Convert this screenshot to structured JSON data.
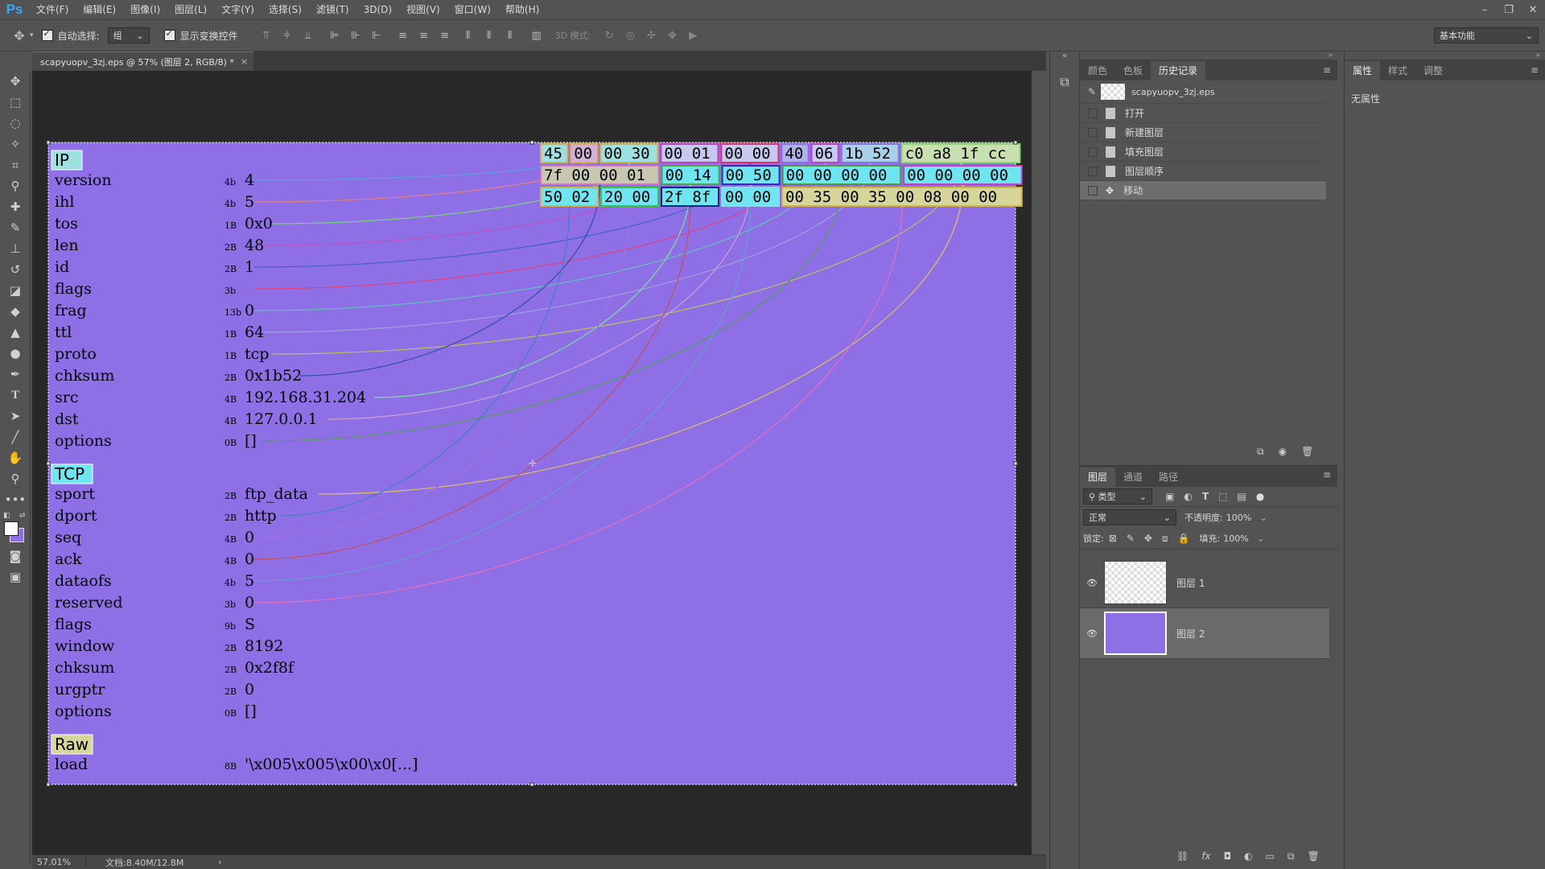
{
  "app": {
    "logo": "Ps",
    "window_controls": [
      "–",
      "❐",
      "✕"
    ]
  },
  "menu": [
    "文件(F)",
    "编辑(E)",
    "图像(I)",
    "图层(L)",
    "文字(Y)",
    "选择(S)",
    "滤镜(T)",
    "3D(D)",
    "视图(V)",
    "窗口(W)",
    "帮助(H)"
  ],
  "options": {
    "auto_select_label": "自动选择:",
    "auto_select_value": "组",
    "show_transform_label": "显示变换控件",
    "mode_3d_label": "3D 模式:",
    "workspace": "基本功能"
  },
  "document": {
    "tab_title": "scapyuopv_3zj.eps @ 57% (图层 2, RGB/8) *",
    "tab_close": "×",
    "zoom": "57.01%",
    "doc_info": "文档:8.40M/12.8M",
    "status_arrow": "›"
  },
  "canvas": {
    "bg_color": "#8e6fe6",
    "sections": [
      {
        "title": "IP",
        "title_bg": "#9ce0e0",
        "fields": [
          {
            "name": "version",
            "size": "4b",
            "value": "4"
          },
          {
            "name": "ihl",
            "size": "4b",
            "value": "5"
          },
          {
            "name": "tos",
            "size": "1B",
            "value": "0x0"
          },
          {
            "name": "len",
            "size": "2B",
            "value": "48"
          },
          {
            "name": "id",
            "size": "2B",
            "value": "1"
          },
          {
            "name": "flags",
            "size": "3b",
            "value": ""
          },
          {
            "name": "frag",
            "size": "13b",
            "value": "0"
          },
          {
            "name": "ttl",
            "size": "1B",
            "value": "64"
          },
          {
            "name": "proto",
            "size": "1B",
            "value": "tcp"
          },
          {
            "name": "chksum",
            "size": "2B",
            "value": "0x1b52"
          },
          {
            "name": "src",
            "size": "4B",
            "value": "192.168.31.204"
          },
          {
            "name": "dst",
            "size": "4B",
            "value": "127.0.0.1"
          },
          {
            "name": "options",
            "size": "0B",
            "value": "[]"
          }
        ]
      },
      {
        "title": "TCP",
        "title_bg": "#6ee6f2",
        "fields": [
          {
            "name": "sport",
            "size": "2B",
            "value": "ftp_data"
          },
          {
            "name": "dport",
            "size": "2B",
            "value": "http"
          },
          {
            "name": "seq",
            "size": "4B",
            "value": "0"
          },
          {
            "name": "ack",
            "size": "4B",
            "value": "0"
          },
          {
            "name": "dataofs",
            "size": "4b",
            "value": "5"
          },
          {
            "name": "reserved",
            "size": "3b",
            "value": "0"
          },
          {
            "name": "flags",
            "size": "9b",
            "value": "S"
          },
          {
            "name": "window",
            "size": "2B",
            "value": "8192"
          },
          {
            "name": "chksum",
            "size": "2B",
            "value": "0x2f8f"
          },
          {
            "name": "urgptr",
            "size": "2B",
            "value": "0"
          },
          {
            "name": "options",
            "size": "0B",
            "value": "[]"
          }
        ]
      },
      {
        "title": "Raw",
        "title_bg": "#d6d69a",
        "fields": [
          {
            "name": "load",
            "size": "8B",
            "value": "'\\x005\\x005\\x00\\x0[...]"
          }
        ]
      }
    ],
    "hex_rows": [
      [
        {
          "text": "45",
          "bg": "#9ce0e0",
          "border": "#d8b04a"
        },
        {
          "text": "00",
          "bg": "#d2b0d8",
          "border": "#d8b04a"
        },
        {
          "text": "00 30",
          "bg": "#9ce0e0",
          "border": "#d8b04a"
        },
        {
          "text": "00 01",
          "bg": "#c6c8ee",
          "border": "#c040c0"
        },
        {
          "text": "00 00",
          "bg": "#c6c8ee",
          "border": "#e03070"
        },
        {
          "text": "40",
          "bg": "#b0b0e8",
          "border": "#8e6fe6"
        },
        {
          "text": "06",
          "bg": "#c6c8ee",
          "border": "#c040c0"
        },
        {
          "text": "1b 52",
          "bg": "#a8d0e8",
          "border": "#8e6fe6"
        },
        {
          "text": "c0 a8 1f cc",
          "bg": "#c8e0b0",
          "border": "#8ad87a"
        }
      ],
      [
        {
          "text": "7f 00 00 01",
          "bg": "#c8c8b0",
          "border": "#d07ab0"
        },
        {
          "text": "00 14",
          "bg": "#6ee6f2",
          "border": "#40b040"
        },
        {
          "text": "00 50",
          "bg": "#6ee6f2",
          "border": "#3030c0"
        },
        {
          "text": "00 00 00 00",
          "bg": "#6ee6f2",
          "border": "#40a040"
        },
        {
          "text": "00 00 00 00",
          "bg": "#6ee6f2",
          "border": "#c040c0"
        }
      ],
      [
        {
          "text": "50 02",
          "bg": "#6ee6f2",
          "border": "#d8b04a"
        },
        {
          "text": "20 00",
          "bg": "#6ee6f2",
          "border": "#40c040"
        },
        {
          "text": "2f 8f",
          "bg": "#6ee6f2",
          "border": "#202080"
        },
        {
          "text": "00 00",
          "bg": "#6ee6f2",
          "border": "#a0d0f0"
        },
        {
          "text": "00 35 00 35 00 08 00 00",
          "bg": "#d6d69a",
          "border": "#d8b04a"
        }
      ]
    ]
  },
  "history_panel": {
    "tabs": [
      "颜色",
      "色板",
      "历史记录"
    ],
    "active_tab": 2,
    "snapshot": "scapyuopv_3zj.eps",
    "items": [
      "打开",
      "新建图层",
      "填充图层",
      "图层顺序",
      "移动"
    ],
    "selected_item": 4
  },
  "properties_panel": {
    "tabs": [
      "属性",
      "样式",
      "调整"
    ],
    "active_tab": 0,
    "content": "无属性"
  },
  "layers_panel": {
    "tabs": [
      "图层",
      "通道",
      "路径"
    ],
    "active_tab": 0,
    "filter_label": "类型",
    "blend_mode": "正常",
    "opacity_label": "不透明度:",
    "opacity": "100%",
    "lock_label": "锁定:",
    "fill_label": "填充:",
    "fill": "100%",
    "layers": [
      {
        "name": "图层 1",
        "thumb": "checker",
        "selected": false
      },
      {
        "name": "图层 2",
        "thumb": "#8e6fe6",
        "selected": true
      }
    ],
    "footer_icons": [
      "link-icon",
      "fx-icon",
      "mask-icon",
      "adjust-icon",
      "folder-icon",
      "new-layer-icon",
      "trash-icon"
    ]
  }
}
